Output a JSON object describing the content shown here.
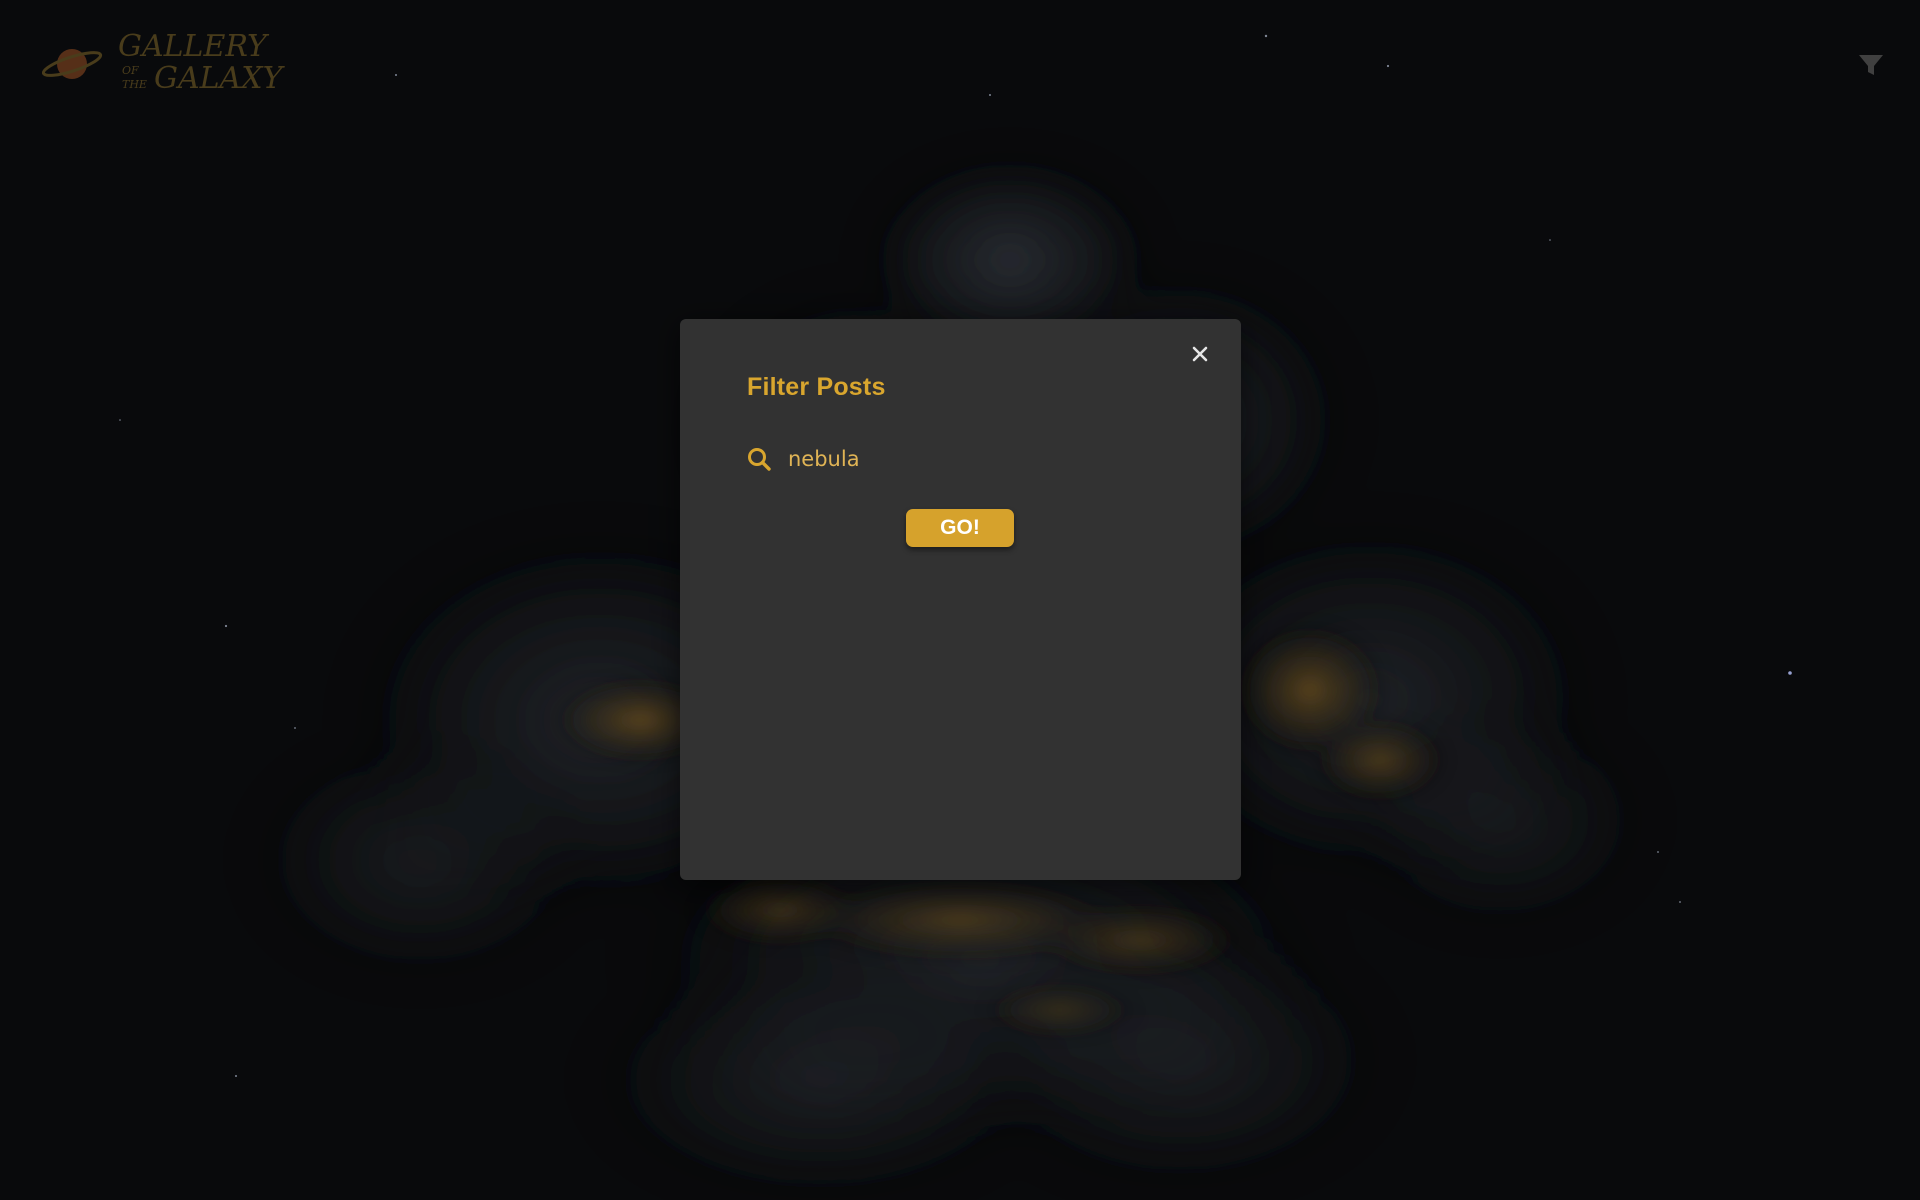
{
  "header": {
    "logo": {
      "line1": "GALLERY",
      "line2_small_a": "OF",
      "line2_small_b": "THE",
      "line2": "GALAXY"
    },
    "filter_icon": "filter-funnel-icon"
  },
  "modal": {
    "title": "Filter Posts",
    "close_icon": "close-x-icon",
    "search": {
      "icon": "search-icon",
      "value": "nebula",
      "placeholder": ""
    },
    "go_label": "GO!"
  },
  "colors": {
    "accent": "#d6a22c",
    "modal_bg": "#323232",
    "page_bg": "#0c0d0f",
    "logo": "#5a4a22"
  }
}
